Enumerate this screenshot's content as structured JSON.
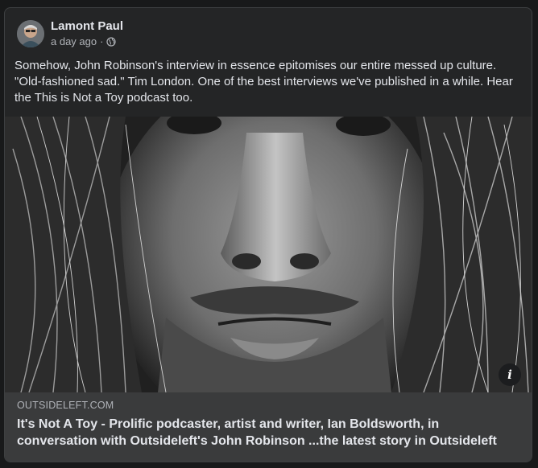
{
  "post": {
    "author": "Lamont Paul",
    "timestamp": "a day ago",
    "separator": "·",
    "audience_icon": "globe-icon",
    "text": "Somehow, John Robinson's interview in essence epitomises our entire messed up culture. \"Old-fashioned sad.\" Tim London. One of the best interviews we've published in a while. Hear the This is Not a Toy podcast too."
  },
  "link_preview": {
    "domain": "OUTSIDELEFT.COM",
    "title": "It's Not A Toy - Prolific podcaster, artist and writer, Ian Boldsworth, in conversation with Outsideleft's John Robinson ...the latest story in Outsideleft",
    "info_label": "i"
  },
  "colors": {
    "background": "#18191a",
    "card": "#242526",
    "preview_footer": "#3a3b3c",
    "text_primary": "#e4e6eb",
    "text_secondary": "#b0b3b8"
  }
}
